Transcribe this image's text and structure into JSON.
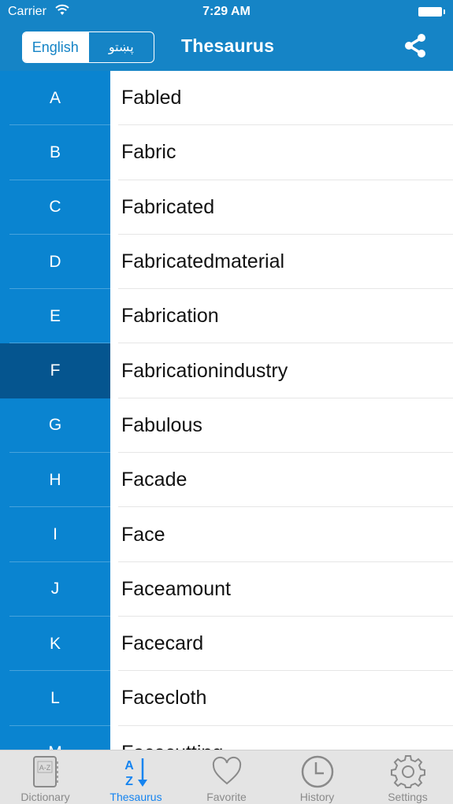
{
  "status_bar": {
    "carrier": "Carrier",
    "time": "7:29 AM"
  },
  "nav": {
    "title": "Thesaurus",
    "segments": [
      {
        "label": "English",
        "active": true
      },
      {
        "label": "پښتو",
        "active": false
      }
    ]
  },
  "index": {
    "selected": "F",
    "letters": [
      "A",
      "B",
      "C",
      "D",
      "E",
      "F",
      "G",
      "H",
      "I",
      "J",
      "K",
      "L",
      "M"
    ]
  },
  "words": [
    "Fabled",
    "Fabric",
    "Fabricated",
    "Fabricatedmaterial",
    "Fabrication",
    "Fabricationindustry",
    "Fabulous",
    "Facade",
    "Face",
    "Faceamount",
    "Facecard",
    "Facecloth",
    "Facecutting"
  ],
  "tabs": [
    {
      "label": "Dictionary",
      "icon": "book-az-icon",
      "active": false
    },
    {
      "label": "Thesaurus",
      "icon": "sort-az-icon",
      "active": true
    },
    {
      "label": "Favorite",
      "icon": "heart-icon",
      "active": false
    },
    {
      "label": "History",
      "icon": "clock-icon",
      "active": false
    },
    {
      "label": "Settings",
      "icon": "gear-icon",
      "active": false
    }
  ],
  "colors": {
    "nav_bg": "#1584c6",
    "sidebar_bg": "#0a84d0",
    "sidebar_selected": "#05558f",
    "tab_active": "#1584f0",
    "tab_inactive": "#8a8a8a"
  }
}
